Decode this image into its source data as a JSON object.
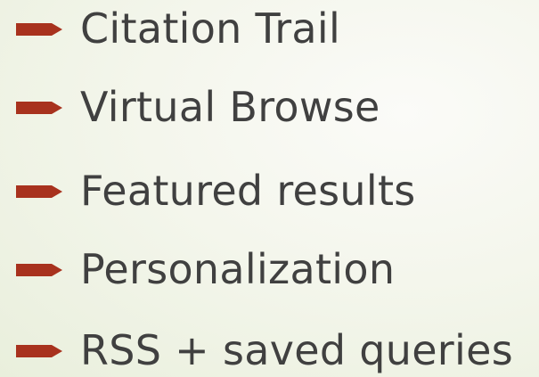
{
  "slide": {
    "accent_color": "#a8321e",
    "text_color": "#404040",
    "bullets": [
      {
        "icon": "arrow-bullet-icon",
        "text": "Citation Trail"
      },
      {
        "icon": "arrow-bullet-icon",
        "text": "Virtual Browse"
      },
      {
        "icon": "arrow-bullet-icon",
        "text": "Featured results"
      },
      {
        "icon": "arrow-bullet-icon",
        "text": "Personalization"
      },
      {
        "icon": "arrow-bullet-icon",
        "text": "RSS + saved queries"
      }
    ]
  }
}
